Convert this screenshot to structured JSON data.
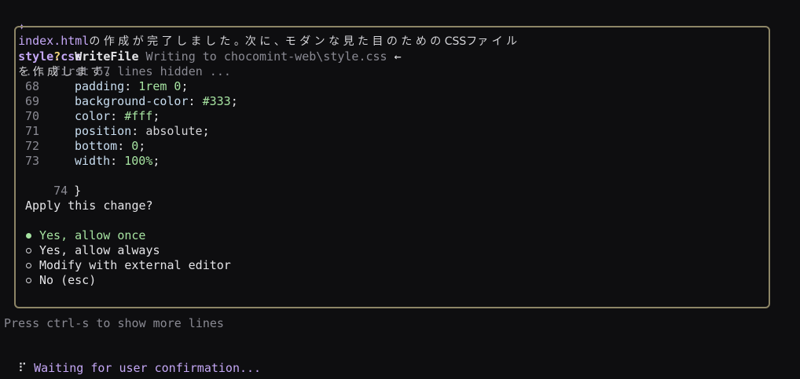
{
  "header": {
    "sparkle": "✦",
    "file_html": "index.html",
    "text1": "の 作 成 が 完 了 し ま し た 。次 に 、モ ダ ン な 見 た 目 の た め の CSSファ イ ル ",
    "file_css": "style.css",
    "text2": "を 作 成 し ま す 。"
  },
  "dialog": {
    "status_char": "?",
    "tool_name": "WriteFile",
    "description": "Writing to chocomint-web\\style.css",
    "arrow": "←",
    "hidden_note": "... first 67 lines hidden ...",
    "code_lines": [
      {
        "n": "68",
        "prop": "padding",
        "value": "1rem 0",
        "value_style": "green"
      },
      {
        "n": "69",
        "prop": "background-color",
        "value": "#333",
        "value_style": "green"
      },
      {
        "n": "70",
        "prop": "color",
        "value": "#fff",
        "value_style": "green"
      },
      {
        "n": "71",
        "prop": "position",
        "value": "absolute",
        "value_style": "plain"
      },
      {
        "n": "72",
        "prop": "bottom",
        "value": "0",
        "value_style": "green"
      },
      {
        "n": "73",
        "prop": "width",
        "value": "100%",
        "value_style": "green"
      }
    ],
    "closing_line": {
      "n": "74",
      "text": "}"
    },
    "question": "Apply this change?",
    "options": [
      {
        "label": "Yes, allow once",
        "selected": true
      },
      {
        "label": "Yes, allow always",
        "selected": false
      },
      {
        "label": "Modify with external editor",
        "selected": false
      },
      {
        "label": "No (esc)",
        "selected": false
      }
    ]
  },
  "footer": {
    "hint": "Press ctrl-s to show more lines",
    "spinner": "⠏",
    "waiting": "Waiting for user confirmation..."
  },
  "colors": {
    "background": "#0e0e10",
    "accent_purple": "#c4a7f5",
    "border": "#8d8566",
    "value_green": "#a6e3a1",
    "status_yellow": "#f0d37a"
  }
}
